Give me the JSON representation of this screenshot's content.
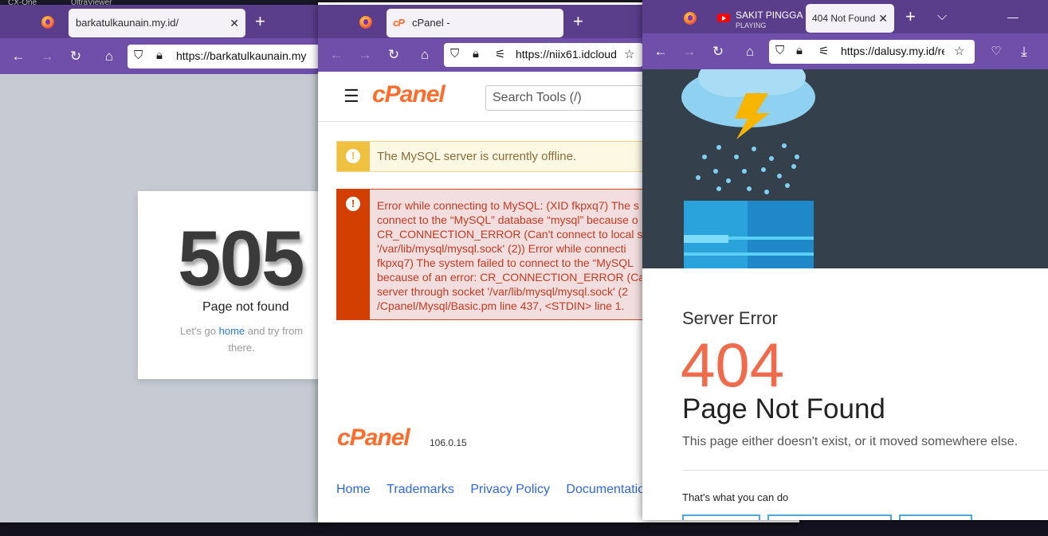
{
  "desktop": {
    "items": [
      "CX-One",
      "UltraViewer"
    ]
  },
  "window1": {
    "tab_title": "barkatulkaunain.my.id/",
    "url": "https://barkatulkaunain.my",
    "error_code": "505",
    "error_title": "Page not found",
    "msg_pre": "Let's go ",
    "msg_link": "home",
    "msg_post": " and try from there."
  },
  "window2": {
    "tab_title": "cPanel -",
    "url": "https://niix61.idcloud",
    "logo": "cPanel",
    "search_placeholder": "Search Tools (/)",
    "warning": "The MySQL server is currently offline.",
    "error_message": "Error while connecting to MySQL: (XID fkpxq7) The s\nconnect to the “MySQL” database “mysql” because o\nCR_CONNECTION_ERROR (Can't connect to local ser\n'/var/lib/mysql/mysql.sock' (2)) Error while connecti\nfkpxq7) The system failed to connect to the “MySQL\nbecause of an error: CR_CONNECTION_ERROR (Can\nserver through socket '/var/lib/mysql/mysql.sock' (2\n/Cpanel/Mysql/Basic.pm line 437, <STDIN> line 1.",
    "version": "106.0.15",
    "footer_links": [
      "Home",
      "Trademarks",
      "Privacy Policy",
      "Documentation"
    ]
  },
  "window3": {
    "media_tab_title": "SAKIT PINGGA",
    "media_tab_status": "PLAYING",
    "tab_title": "404 Not Found",
    "url": "https://dalusy.my.id/re",
    "heading": "Server Error",
    "error_code": "404",
    "error_title": "Page Not Found",
    "message": "This page either doesn't exist, or it moved somewhere else.",
    "actions_heading": "That's what you can do"
  },
  "colors": {
    "tabstrip": "#5a3e8c",
    "toolbar": "#6f4fa9",
    "cpanel_orange": "#ff6c2c",
    "error_red": "#d23f00",
    "warning_yellow": "#f0c040",
    "accent_404": "#f06b4c"
  }
}
